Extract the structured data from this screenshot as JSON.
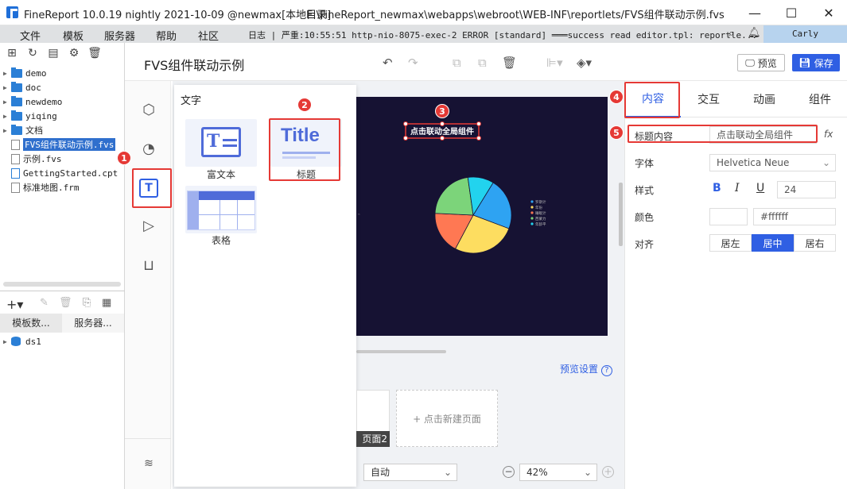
{
  "window": {
    "app_title": "FineReport 10.0.19 nightly 2021-10-09 @newmax[本地目录]",
    "file_path": "E:\\FineReport_newmax\\webapps\\webroot\\WEB-INF\\reportlets/FVS组件联动示例.fvs",
    "minimize": "—",
    "maximize": "☐",
    "close": "✕"
  },
  "menu": {
    "items": [
      "文件",
      "模板",
      "服务器",
      "帮助",
      "社区"
    ],
    "log": "日志 | 严重:10:55:51 http-nio-8075-exec-2 ERROR [standard] ═══success read editor.tpl: reportle...",
    "user": "Carly"
  },
  "tree": {
    "items": [
      {
        "label": "demo",
        "type": "folder"
      },
      {
        "label": "doc",
        "type": "folder"
      },
      {
        "label": "newdemo",
        "type": "folder"
      },
      {
        "label": "yiqing",
        "type": "folder"
      },
      {
        "label": "文档",
        "type": "folder"
      },
      {
        "label": "FVS组件联动示例.fvs",
        "type": "file",
        "selected": true
      },
      {
        "label": "示例.fvs",
        "type": "file"
      },
      {
        "label": "GettingStarted.cpt",
        "type": "file"
      },
      {
        "label": "标准地图.frm",
        "type": "file"
      }
    ],
    "bottom_tabs": [
      "模板数...",
      "服务器..."
    ],
    "datasource": "ds1"
  },
  "designer": {
    "doc_title": "FVS组件联动示例",
    "preview_label": "预览",
    "save_label": "保存"
  },
  "popup": {
    "title": "文字",
    "items": [
      {
        "label": "富文本",
        "icon": "rich-text-icon"
      },
      {
        "label": "标题",
        "icon": "title-icon",
        "glyph": "Title"
      },
      {
        "label": "表格",
        "icon": "table-icon"
      }
    ]
  },
  "canvas": {
    "title_text": "点击联动全局组件",
    "legend": [
      "罗斯计",
      "年份",
      "睡眠计",
      "西蒙力",
      "年龄平"
    ],
    "pie_colors": [
      "#2ea3f2",
      "#fddd60",
      "#ff7853",
      "#7cd47a",
      "#22d3ee"
    ]
  },
  "bottom": {
    "preview_settings": "预览设置",
    "page2": "页面2",
    "new_page": "+ 点击新建页面",
    "auto": "自动",
    "zoom": "42%"
  },
  "props": {
    "tabs": [
      "内容",
      "交互",
      "动画",
      "组件"
    ],
    "title_content_label": "标题内容",
    "title_content_value": "点击联动全局组件",
    "fx": "fx",
    "font_label": "字体",
    "font_value": "Helvetica Neue",
    "style_label": "样式",
    "bold": "B",
    "italic": "I",
    "underline": "U",
    "font_size": "24",
    "color_label": "颜色",
    "color_value": "#ffffff",
    "align_label": "对齐",
    "align_options": [
      "居左",
      "居中",
      "居右"
    ]
  },
  "annotations": [
    "1",
    "2",
    "3",
    "4",
    "5"
  ]
}
